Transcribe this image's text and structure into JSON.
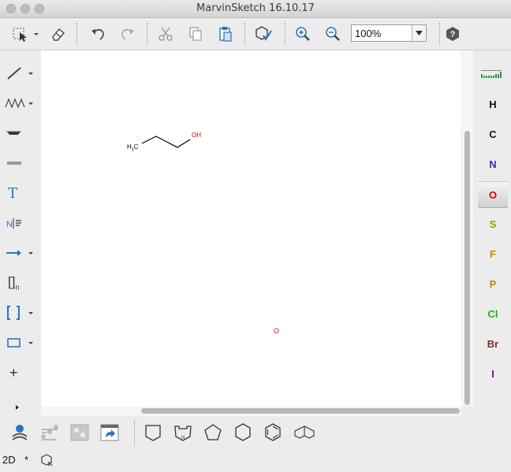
{
  "window": {
    "title": "MarvinSketch 16.10.17"
  },
  "toolbar": {
    "zoom_value": "100%"
  },
  "canvas": {
    "molecule": {
      "atom_h3c": "H",
      "atom_h3c_sub": "3",
      "atom_c": "C",
      "atom_oh": "OH"
    },
    "stray_atom": "O"
  },
  "periodic_bar": {
    "atoms": [
      {
        "symbol": "H",
        "color": "#111111"
      },
      {
        "symbol": "C",
        "color": "#111111"
      },
      {
        "symbol": "N",
        "color": "#3030c8"
      },
      {
        "symbol": "O",
        "color": "#e00000"
      },
      {
        "symbol": "S",
        "color": "#9a9a00"
      },
      {
        "symbol": "F",
        "color": "#cc8800"
      },
      {
        "symbol": "P",
        "color": "#cc8800"
      },
      {
        "symbol": "Cl",
        "color": "#20b020"
      },
      {
        "symbol": "Br",
        "color": "#8b2a2a"
      },
      {
        "symbol": "I",
        "color": "#8a00a8"
      }
    ],
    "selected": "O"
  },
  "left_tools": {
    "text_tool_label": "T",
    "bracket_label": "[]",
    "bracket_sub": "n",
    "plus_label": "+"
  },
  "statusbar": {
    "mode": "2D",
    "star": "*"
  },
  "icons": {
    "select": "select-icon",
    "erase": "eraser-icon",
    "undo": "undo-icon",
    "redo": "redo-icon",
    "cut": "cut-icon",
    "copy": "copy-icon",
    "paste": "paste-icon",
    "clean": "clean-structure-icon",
    "zoom_in": "zoom-in-icon",
    "zoom_out": "zoom-out-icon",
    "help": "help-icon"
  }
}
